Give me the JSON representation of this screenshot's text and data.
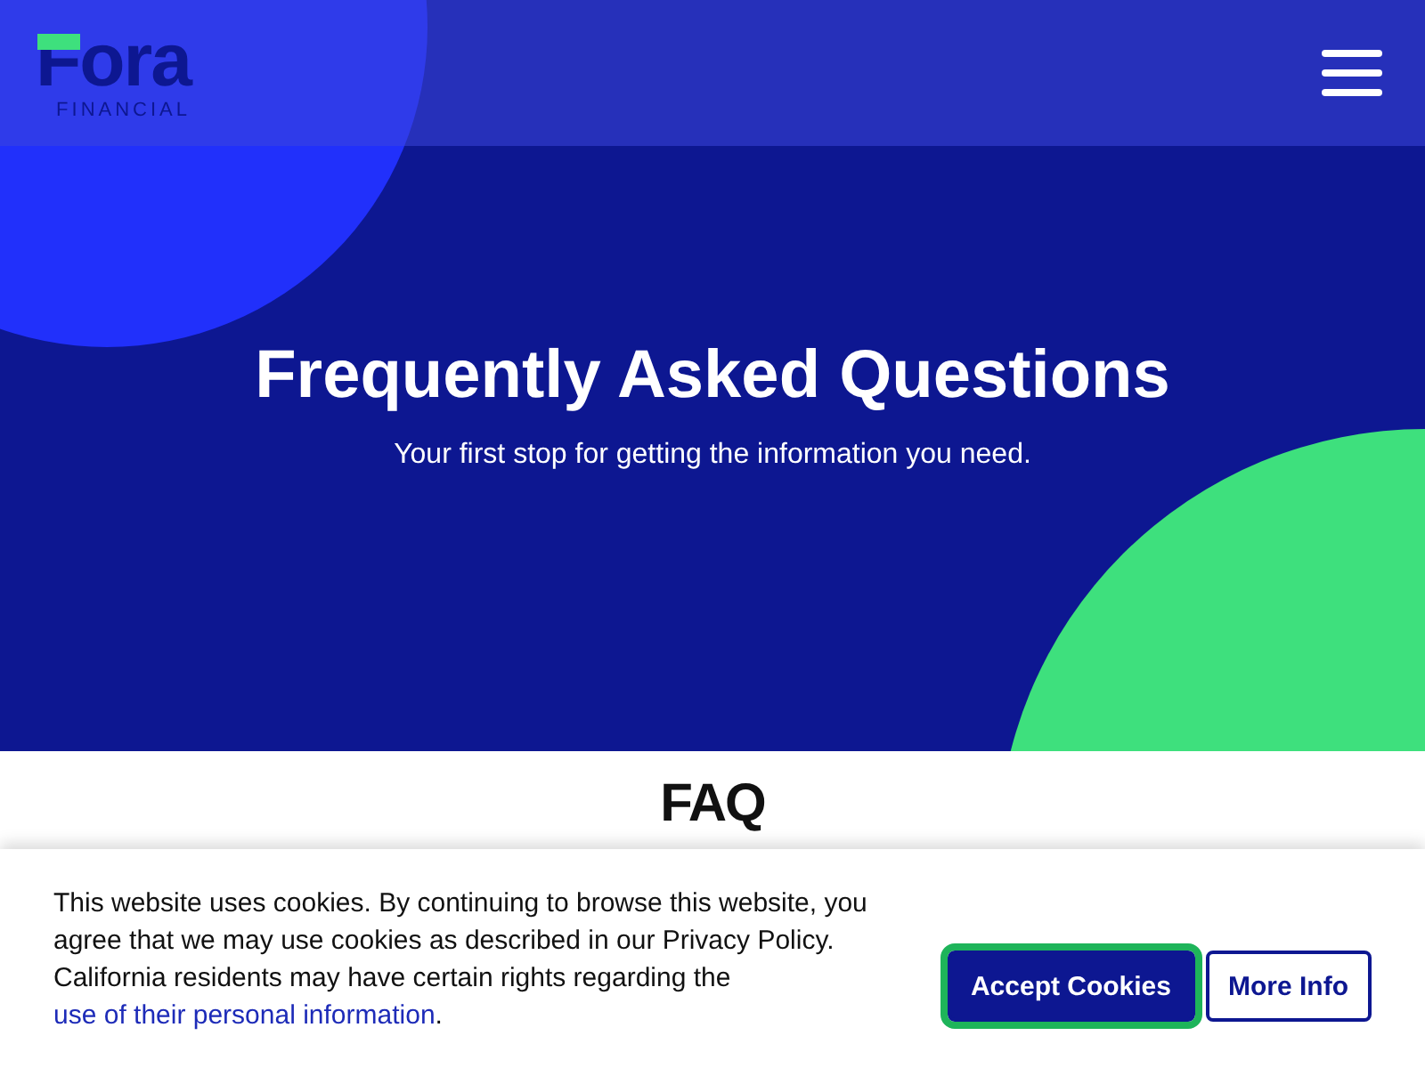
{
  "header": {
    "logo": {
      "word": "Fora",
      "tagline": "FINANCIAL"
    }
  },
  "hero": {
    "title": "Frequently Asked Questions",
    "subtitle": "Your first stop for getting the information you need."
  },
  "section": {
    "heading": "FAQ"
  },
  "cookie_banner": {
    "text": "This website uses cookies. By continuing to browse this website, you agree that we may use cookies as described in our Privacy Policy. California residents may have certain rights regarding the ",
    "link": "use of their personal information",
    "after": ".",
    "buttons": [
      {
        "label": "Accept Cookies",
        "kind": "primary",
        "focused": true
      },
      {
        "label": "More Info",
        "kind": "outline",
        "focused": false
      }
    ]
  }
}
